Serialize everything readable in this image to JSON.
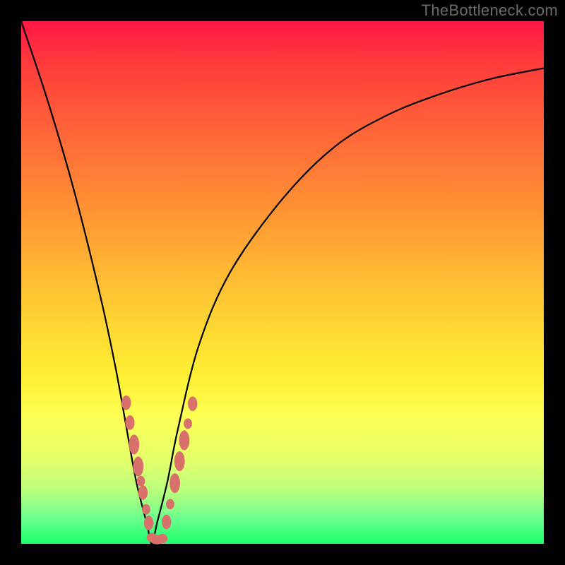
{
  "watermark": "TheBottleneck.com",
  "chart_data": {
    "type": "line",
    "title": "",
    "xlabel": "",
    "ylabel": "",
    "xlim": [
      0,
      100
    ],
    "ylim": [
      0,
      100
    ],
    "series": [
      {
        "name": "bottleneck-curve",
        "x": [
          0,
          5,
          10,
          15,
          18,
          20,
          22,
          24,
          25,
          26,
          28,
          30,
          34,
          40,
          50,
          60,
          70,
          80,
          90,
          100
        ],
        "y": [
          100,
          85,
          68,
          48,
          34,
          23,
          12,
          4,
          0,
          4,
          12,
          22,
          38,
          52,
          66,
          76,
          82,
          86,
          89,
          91
        ]
      }
    ],
    "markers": {
      "name": "highlighted-points",
      "color": "#d9716b",
      "points": [
        {
          "x": 20.1,
          "y": 27.0,
          "rx": 0.9,
          "ry": 1.4
        },
        {
          "x": 20.8,
          "y": 23.2,
          "rx": 0.9,
          "ry": 1.4
        },
        {
          "x": 21.6,
          "y": 19.0,
          "rx": 1.0,
          "ry": 1.9
        },
        {
          "x": 22.4,
          "y": 14.8,
          "rx": 1.0,
          "ry": 1.9
        },
        {
          "x": 22.9,
          "y": 12.0,
          "rx": 0.8,
          "ry": 1.0
        },
        {
          "x": 23.3,
          "y": 9.8,
          "rx": 0.9,
          "ry": 1.4
        },
        {
          "x": 23.9,
          "y": 6.6,
          "rx": 0.8,
          "ry": 1.0
        },
        {
          "x": 24.4,
          "y": 4.0,
          "rx": 0.9,
          "ry": 1.4
        },
        {
          "x": 25.0,
          "y": 1.2,
          "rx": 1.0,
          "ry": 0.9
        },
        {
          "x": 26.0,
          "y": 0.8,
          "rx": 1.4,
          "ry": 0.9
        },
        {
          "x": 27.0,
          "y": 1.0,
          "rx": 1.0,
          "ry": 0.9
        },
        {
          "x": 27.8,
          "y": 4.2,
          "rx": 0.9,
          "ry": 1.4
        },
        {
          "x": 28.5,
          "y": 7.6,
          "rx": 0.8,
          "ry": 1.0
        },
        {
          "x": 29.4,
          "y": 11.6,
          "rx": 1.0,
          "ry": 1.9
        },
        {
          "x": 30.3,
          "y": 15.8,
          "rx": 1.0,
          "ry": 1.9
        },
        {
          "x": 31.2,
          "y": 19.8,
          "rx": 1.0,
          "ry": 1.9
        },
        {
          "x": 31.9,
          "y": 23.0,
          "rx": 0.8,
          "ry": 1.0
        },
        {
          "x": 32.8,
          "y": 26.8,
          "rx": 0.9,
          "ry": 1.4
        }
      ]
    }
  }
}
